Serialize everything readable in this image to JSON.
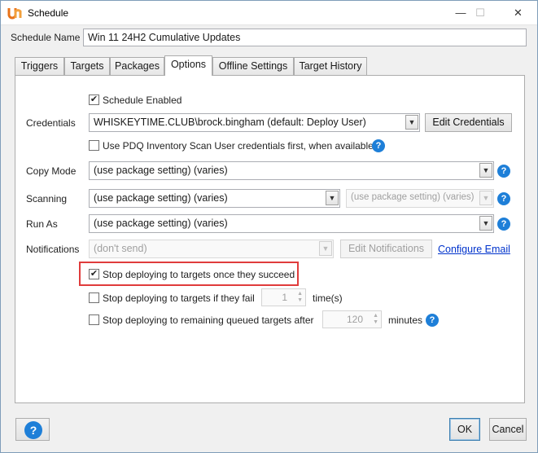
{
  "window": {
    "title": "Schedule",
    "controls": {
      "minimize": "—",
      "maximize": "☐",
      "close": "✕"
    },
    "icon": "pdq-logo-icon"
  },
  "schedule_name": {
    "label": "Schedule Name",
    "value": "Win 11 24H2 Cumulative Updates"
  },
  "tabs": [
    {
      "label": "Triggers",
      "active": false
    },
    {
      "label": "Targets",
      "active": false
    },
    {
      "label": "Packages",
      "active": false
    },
    {
      "label": "Options",
      "active": true
    },
    {
      "label": "Offline Settings",
      "active": false
    },
    {
      "label": "Target History",
      "active": false
    }
  ],
  "options": {
    "schedule_enabled": {
      "label": "Schedule Enabled",
      "checked": true
    },
    "credentials": {
      "label": "Credentials",
      "value": "WHISKEYTIME.CLUB\\brock.bingham (default: Deploy User)",
      "button": "Edit Credentials"
    },
    "pdq_inventory": {
      "label": "Use PDQ Inventory Scan User credentials first, when available",
      "checked": false
    },
    "copy_mode": {
      "label": "Copy Mode",
      "value": "(use package setting) (varies)"
    },
    "scanning": {
      "label": "Scanning",
      "value": "(use package setting) (varies)",
      "secondary_value": "(use package setting) (varies)"
    },
    "run_as": {
      "label": "Run As",
      "value": "(use package setting) (varies)"
    },
    "notifications": {
      "label": "Notifications",
      "value": "(don't send)",
      "button": "Edit Notifications",
      "link": "Configure Email"
    },
    "stop_on_success": {
      "label": "Stop deploying to targets once they succeed",
      "checked": true
    },
    "stop_on_fail": {
      "label": "Stop deploying to targets if they fail",
      "value": "1",
      "unit": "time(s)",
      "checked": false
    },
    "stop_queued": {
      "label": "Stop deploying to remaining queued targets after",
      "value": "120",
      "unit": "minutes",
      "checked": false
    }
  },
  "footer": {
    "help": "?",
    "ok": "OK",
    "cancel": "Cancel"
  },
  "colors": {
    "highlight": "#e03c3c",
    "help_blue": "#1e7fd8",
    "link": "#0033cc"
  }
}
